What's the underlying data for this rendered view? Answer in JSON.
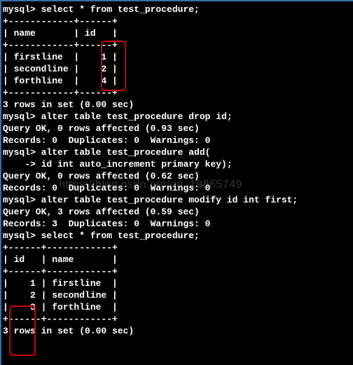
{
  "block1": {
    "cmd": "mysql> select * from test_procedure;",
    "divider": "+------------+------+",
    "header": "| name       | id   |",
    "row1": "| firstline  |    1 |",
    "row2": "| secondline |    2 |",
    "row3": "| forthline  |    4 |",
    "footer": "3 rows in set (0.00 sec)"
  },
  "block2": {
    "cmd": "mysql> alter table test_procedure drop id;",
    "l1": "Query OK, 0 rows affected (0.93 sec)",
    "l2": "Records: 0  Duplicates: 0  Warnings: 0"
  },
  "block3": {
    "cmd": "mysql> alter table test_procedure add(",
    "cont": "    -> id int auto_increment primary key);",
    "l1": "Query OK, 0 rows affected (0.62 sec)",
    "l2": "Records: 0  Duplicates: 0  Warnings: 0"
  },
  "block4": {
    "cmd": "mysql> alter table test_procedure modify id int first;",
    "l1": "Query OK, 3 rows affected (0.59 sec)",
    "l2": "Records: 3  Duplicates: 0  Warnings: 0"
  },
  "block5": {
    "cmd": "mysql> select * from test_procedure;",
    "divider": "+------+------------+",
    "header": "| id   | name       |",
    "row1": "|    1 | firstline  |",
    "row2": "|    2 | secondline |",
    "row3": "|    3 | forthline  |",
    "footer": "3 rows in set (0.00 sec)"
  },
  "watermark": "https://blog.csdn.net/qq_19865749"
}
